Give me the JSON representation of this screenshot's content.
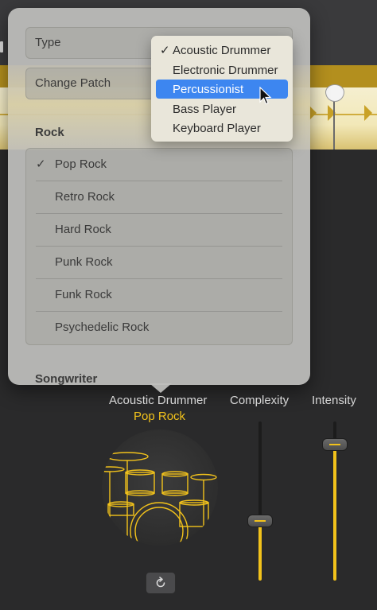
{
  "popover": {
    "type_label": "Type",
    "change_patch_label": "Change Patch",
    "section_title": "Rock",
    "styles": [
      {
        "label": "Pop Rock",
        "checked": true
      },
      {
        "label": "Retro Rock",
        "checked": false
      },
      {
        "label": "Hard Rock",
        "checked": false
      },
      {
        "label": "Punk Rock",
        "checked": false
      },
      {
        "label": "Funk Rock",
        "checked": false
      },
      {
        "label": "Psychedelic Rock",
        "checked": false
      }
    ],
    "next_section_title": "Songwriter",
    "check_glyph": "✓"
  },
  "type_menu": {
    "items": [
      {
        "label": "Acoustic Drummer",
        "checked": true,
        "highlighted": false
      },
      {
        "label": "Electronic Drummer",
        "checked": false,
        "highlighted": false
      },
      {
        "label": "Percussionist",
        "checked": false,
        "highlighted": true
      },
      {
        "label": "Bass Player",
        "checked": false,
        "highlighted": false
      },
      {
        "label": "Keyboard Player",
        "checked": false,
        "highlighted": false
      }
    ],
    "check_glyph": "✓"
  },
  "editor": {
    "drummer_type": "Acoustic Drummer",
    "style_name": "Pop Rock",
    "complexity_label": "Complexity",
    "intensity_label": "Intensity",
    "complexity_value": 0.38,
    "intensity_value": 0.86,
    "refresh_icon": "refresh-icon"
  },
  "colors": {
    "accent": "#f2c21b",
    "selection": "#3d86f0",
    "region": "#c9a227"
  }
}
